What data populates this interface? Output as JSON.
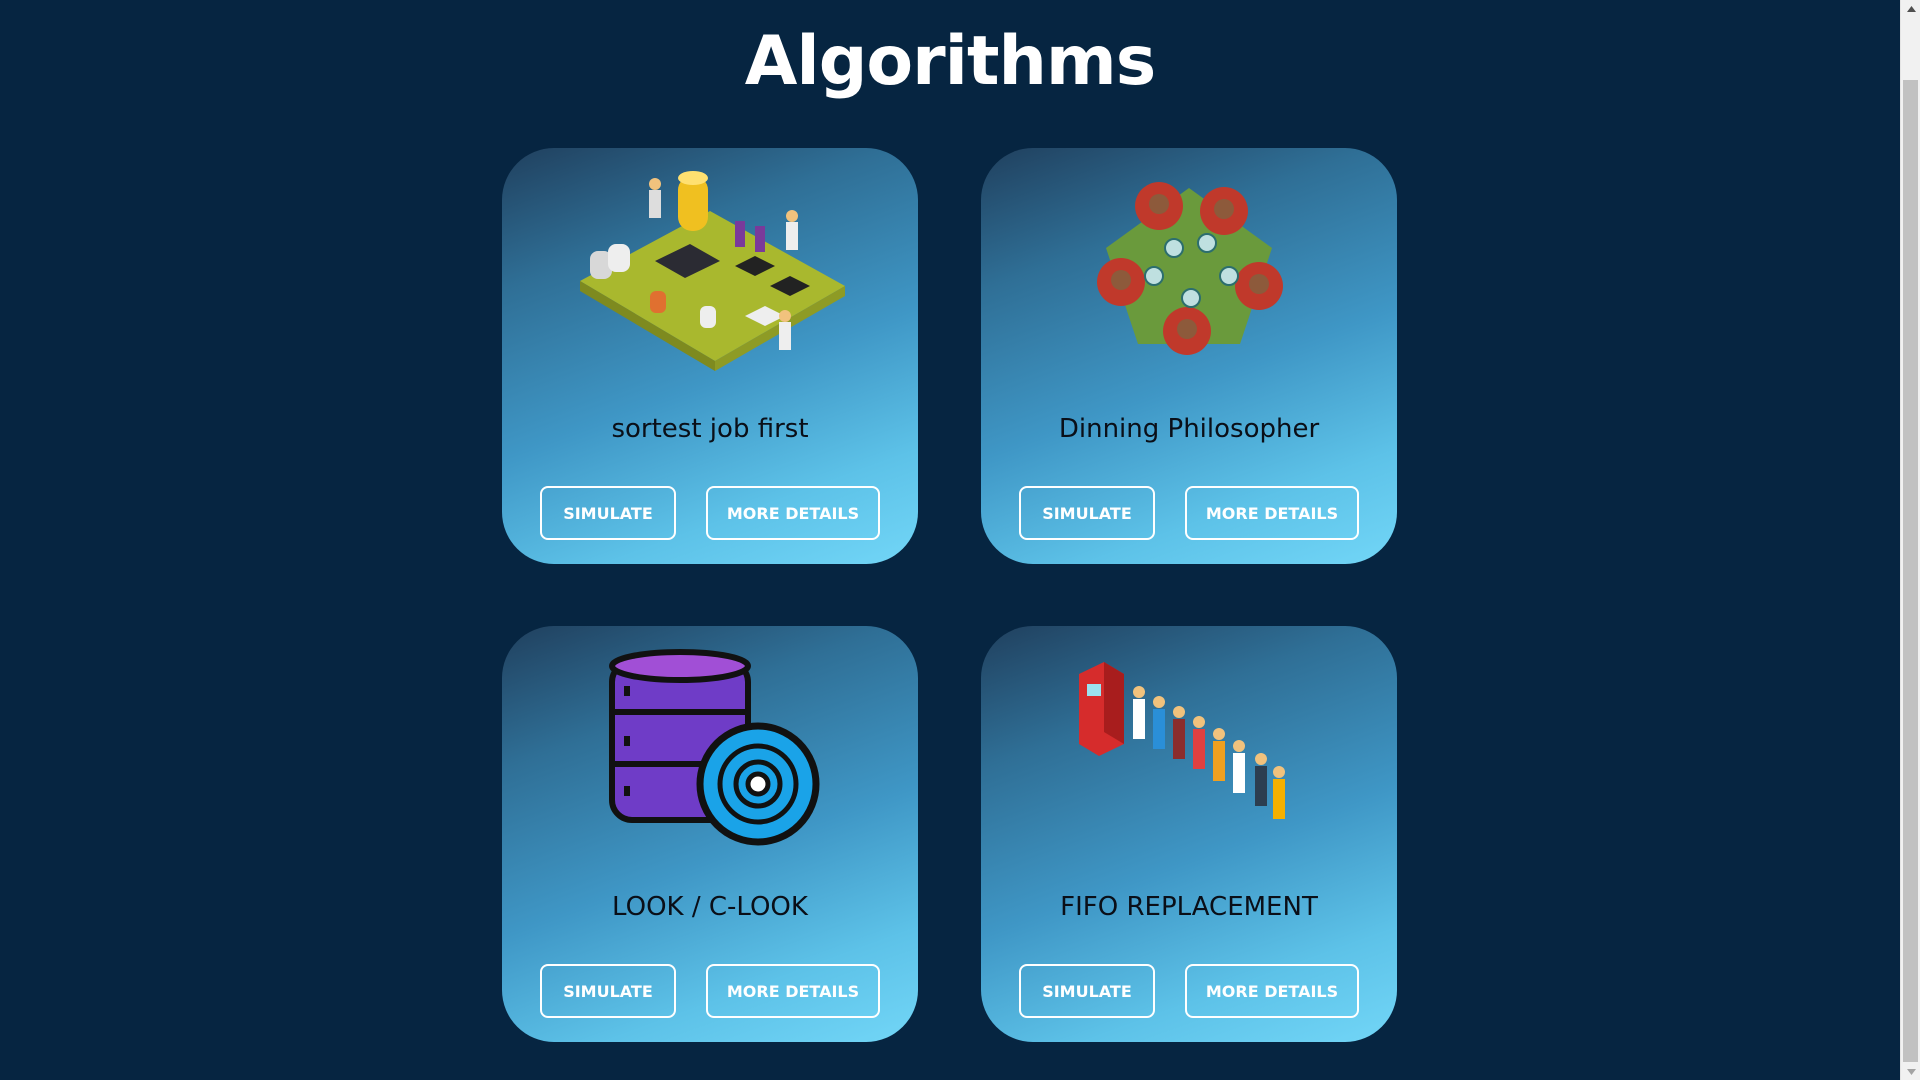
{
  "page": {
    "title": "Algorithms"
  },
  "cards": [
    {
      "title": "sortest job first",
      "simulate_label": "SIMULATE",
      "details_label": "MORE DETAILS",
      "image": "circuit-board-illustration"
    },
    {
      "title": "Dinning Philosopher",
      "simulate_label": "SIMULATE",
      "details_label": "MORE DETAILS",
      "image": "dining-table-illustration"
    },
    {
      "title": "LOOK / C-LOOK",
      "simulate_label": "SIMULATE",
      "details_label": "MORE DETAILS",
      "image": "disk-database-icon"
    },
    {
      "title": "FIFO REPLACEMENT",
      "simulate_label": "SIMULATE",
      "details_label": "MORE DETAILS",
      "image": "atm-queue-illustration"
    }
  ],
  "colors": {
    "background": "#062541",
    "card_gradient_start": "#20405e",
    "card_gradient_end": "#72d6f7",
    "button_border": "#ffffff"
  }
}
